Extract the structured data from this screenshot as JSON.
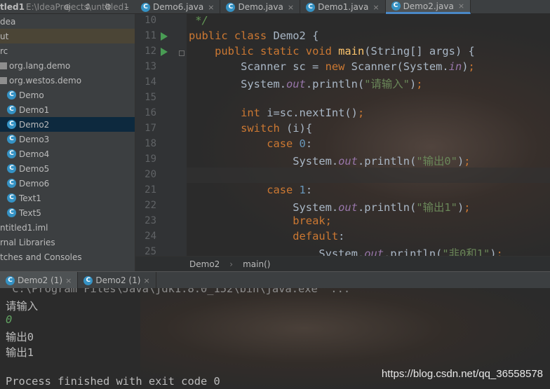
{
  "project_header": {
    "name": "tled1",
    "path": "E:\\IdeaProjects\\untitled1"
  },
  "toolbar_icons": [
    "target-icon",
    "collapse-icon",
    "gear-icon",
    "hide-icon"
  ],
  "tabs": [
    {
      "label": "Demo6.java",
      "close": "×",
      "active": false
    },
    {
      "label": "Demo.java",
      "close": "×",
      "active": false
    },
    {
      "label": "Demo1.java",
      "close": "×",
      "active": false
    },
    {
      "label": "Demo2.java",
      "close": "×",
      "active": true
    }
  ],
  "tree": [
    {
      "label": "dea",
      "type": "folder",
      "x": 0
    },
    {
      "label": "ut",
      "type": "folder",
      "x": 0,
      "excluded": true
    },
    {
      "label": "rc",
      "type": "folder",
      "x": 0
    },
    {
      "label": "org.lang.demo",
      "type": "package",
      "x": 0
    },
    {
      "label": "org.westos.demo",
      "type": "package",
      "x": 0
    },
    {
      "label": "Demo",
      "type": "class",
      "x": 0
    },
    {
      "label": "Demo1",
      "type": "class",
      "x": 0
    },
    {
      "label": "Demo2",
      "type": "class",
      "x": 0,
      "selected": true
    },
    {
      "label": "Demo3",
      "type": "class",
      "x": 0
    },
    {
      "label": "Demo4",
      "type": "class",
      "x": 0
    },
    {
      "label": "Demo5",
      "type": "class",
      "x": 0
    },
    {
      "label": "Demo6",
      "type": "class",
      "x": 0
    },
    {
      "label": "Text1",
      "type": "class",
      "x": 0
    },
    {
      "label": "Text5",
      "type": "class",
      "x": 0
    },
    {
      "label": "ntitled1.iml",
      "type": "file",
      "x": 0
    },
    {
      "label": "rnal Libraries",
      "type": "lib",
      "x": 0
    },
    {
      "label": "tches and Consoles",
      "type": "lib",
      "x": 0
    }
  ],
  "code_lines": [
    {
      "n": "10",
      "html": "<span class=\"cmt\"> */</span>"
    },
    {
      "n": "11",
      "html": "<span class=\"kw\">public class </span>Demo2 {"
    },
    {
      "n": "12",
      "html": "    <span class=\"kw\">public static void </span><span class=\"fn\">main</span>(String[] args) {"
    },
    {
      "n": "13",
      "html": "        Scanner sc = <span class=\"kw\">new </span>Scanner(System.<span class=\"fld\">in</span>)<span class=\"kw\">;</span>"
    },
    {
      "n": "14",
      "html": "        System.<span class=\"fld\">out</span>.println(<span class=\"str\">\"请输入\"</span>)<span class=\"kw\">;</span>"
    },
    {
      "n": "15",
      "html": ""
    },
    {
      "n": "16",
      "html": "        <span class=\"kw\">int </span>i=sc.nextInt()<span class=\"kw\">;</span>"
    },
    {
      "n": "17",
      "html": "        <span class=\"kw\">switch </span>(i){"
    },
    {
      "n": "18",
      "html": "            <span class=\"kw\">case </span><span class=\"num\">0</span>:"
    },
    {
      "n": "19",
      "html": "                System.<span class=\"fld\">out</span>.println(<span class=\"str\">\"输出0\"</span>)<span class=\"kw\">;</span>"
    },
    {
      "n": "20",
      "html": ""
    },
    {
      "n": "21",
      "html": "            <span class=\"kw\">case </span><span class=\"num\">1</span>:"
    },
    {
      "n": "22",
      "html": "                System.<span class=\"fld\">out</span>.println(<span class=\"str\">\"输出1\"</span>)<span class=\"kw\">;</span>"
    },
    {
      "n": "23",
      "html": "                <span class=\"kw\">break;</span>"
    },
    {
      "n": "24",
      "html": "                <span class=\"kw\">default</span>:"
    },
    {
      "n": "25",
      "html": "                    System.<span class=\"fld\">out</span>.println(<span class=\"str\">\"非0和1\"</span>)<span class=\"kw\">;</span>"
    }
  ],
  "breadcrumb": {
    "class_name": "Demo2",
    "method_name": "main()",
    "separator": "›"
  },
  "run_tabs": [
    {
      "label": "Demo2 (1)",
      "close": "×",
      "active": true
    },
    {
      "label": "Demo2 (1)",
      "close": "×",
      "active": false
    }
  ],
  "console": {
    "command": " C:\\Program Files\\Java\\jdk1.8.0_152\\bin\\java.exe\" ...",
    "lines": [
      {
        "text": "请输入",
        "kind": "out"
      },
      {
        "text": "0",
        "kind": "input"
      },
      {
        "text": "输出0",
        "kind": "out"
      },
      {
        "text": "输出1",
        "kind": "out"
      },
      {
        "text": "",
        "kind": "out"
      },
      {
        "text": "Process finished with exit code 0",
        "kind": "out"
      }
    ]
  },
  "watermark": "https://blog.csdn.net/qq_36558578",
  "colors": {
    "accent": "#4a88c7",
    "keyword": "#cc7832",
    "string": "#6a8759",
    "method": "#ffc66d",
    "field": "#9876aa",
    "selection": "#0d293e"
  }
}
